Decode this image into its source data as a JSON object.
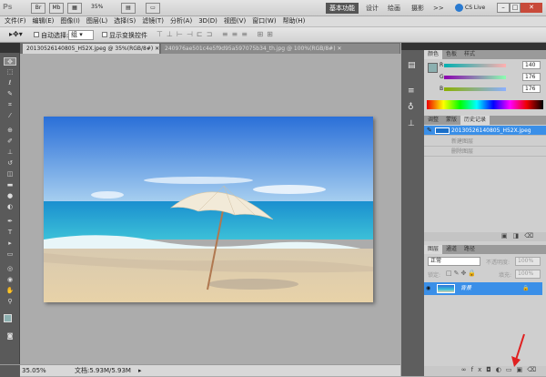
{
  "app": {
    "zoom_menu": "35%",
    "workspaces": [
      "基本功能",
      "设计",
      "绘画",
      "摄影"
    ],
    "more": ">>",
    "cs_live": "CS Live"
  },
  "menu": [
    "文件(F)",
    "编辑(E)",
    "图像(I)",
    "图层(L)",
    "选择(S)",
    "滤镜(T)",
    "分析(A)",
    "3D(D)",
    "视图(V)",
    "窗口(W)",
    "帮助(H)"
  ],
  "options": {
    "auto_select": "自动选择:",
    "auto_select_value": "组",
    "show_transform": "显示变换控件"
  },
  "documents": [
    {
      "label": "20130526140805_H52X.jpeg @ 35%(RGB/8#)",
      "active": true
    },
    {
      "label": "240976ae501c4e5f9d95a597075b34_th.jpg @ 100%(RGB/8#)",
      "active": false
    }
  ],
  "status": {
    "zoom": "35.05%",
    "doc": "文档:5.93M/5.93M"
  },
  "color_panel": {
    "tabs": [
      "颜色",
      "色板",
      "样式"
    ],
    "R": "140",
    "G": "176",
    "B": "176",
    "foreground": "#8cb0b0"
  },
  "history_panel": {
    "tabs": [
      "调整",
      "蒙版",
      "历史记录"
    ],
    "snapshot": "20130526140805_H52X.jpeg",
    "items": [
      "新建图层",
      "删除图层"
    ]
  },
  "layers_panel": {
    "tabs": [
      "图层",
      "通道",
      "路径"
    ],
    "blend": "正常",
    "opacity_label": "不透明度:",
    "opacity": "100%",
    "lock_label": "锁定:",
    "fill_label": "填充:",
    "fill": "100%",
    "layers": [
      {
        "name": "背景",
        "selected": true
      }
    ]
  },
  "colors": {
    "accent": "#3a8fe8",
    "arrow": "#e02020"
  }
}
